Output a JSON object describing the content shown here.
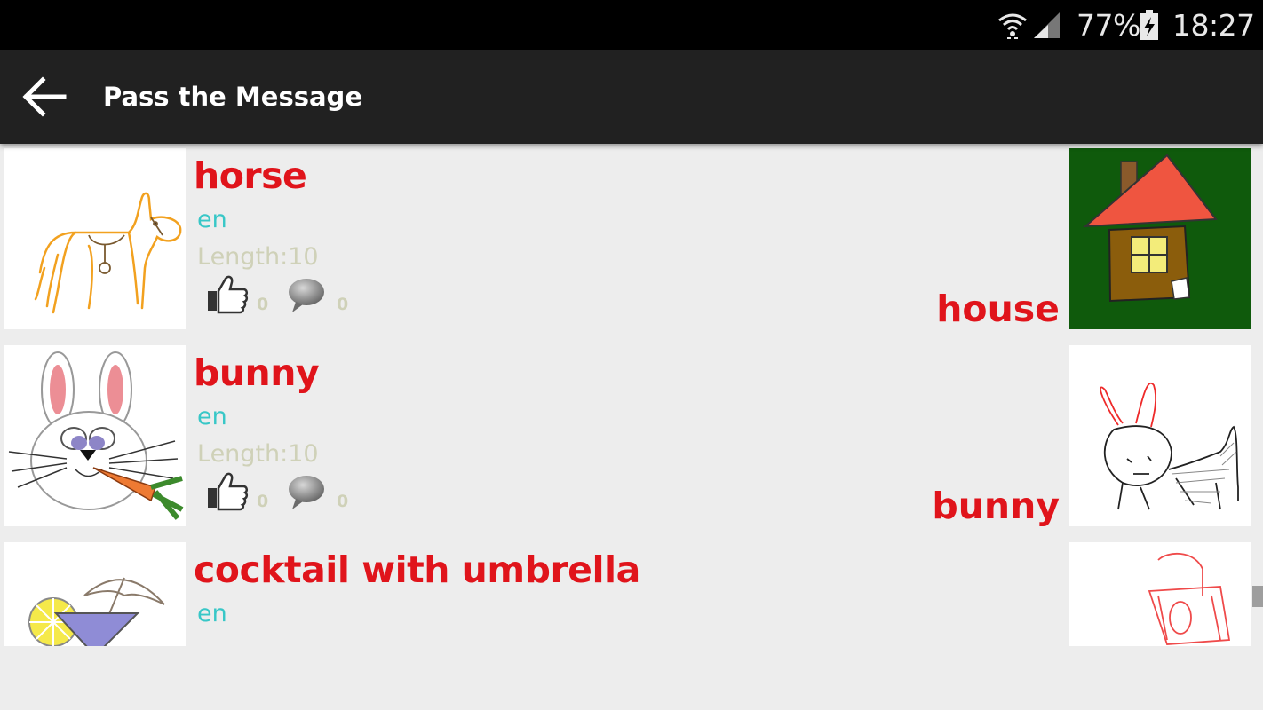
{
  "status_bar": {
    "battery": "77%",
    "time": "18:27",
    "wifi_icon": "wifi-icon",
    "signal_icon": "signal-icon",
    "battery_icon": "battery-charging-icon"
  },
  "app_bar": {
    "title": "Pass the Message",
    "back_icon": "arrow-left-icon"
  },
  "colors": {
    "word": "#e0141b",
    "lang": "#38c7c7",
    "meta": "#cfd1b8",
    "app_bar": "#212121",
    "background": "#ededed"
  },
  "items": [
    {
      "word": "horse",
      "lang": "en",
      "length": "Length:10",
      "likes": "0",
      "comments": "0",
      "guess": "house"
    },
    {
      "word": "bunny",
      "lang": "en",
      "length": "Length:10",
      "likes": "0",
      "comments": "0",
      "guess": "bunny"
    },
    {
      "word": "cocktail with umbrella",
      "lang": "en"
    }
  ]
}
